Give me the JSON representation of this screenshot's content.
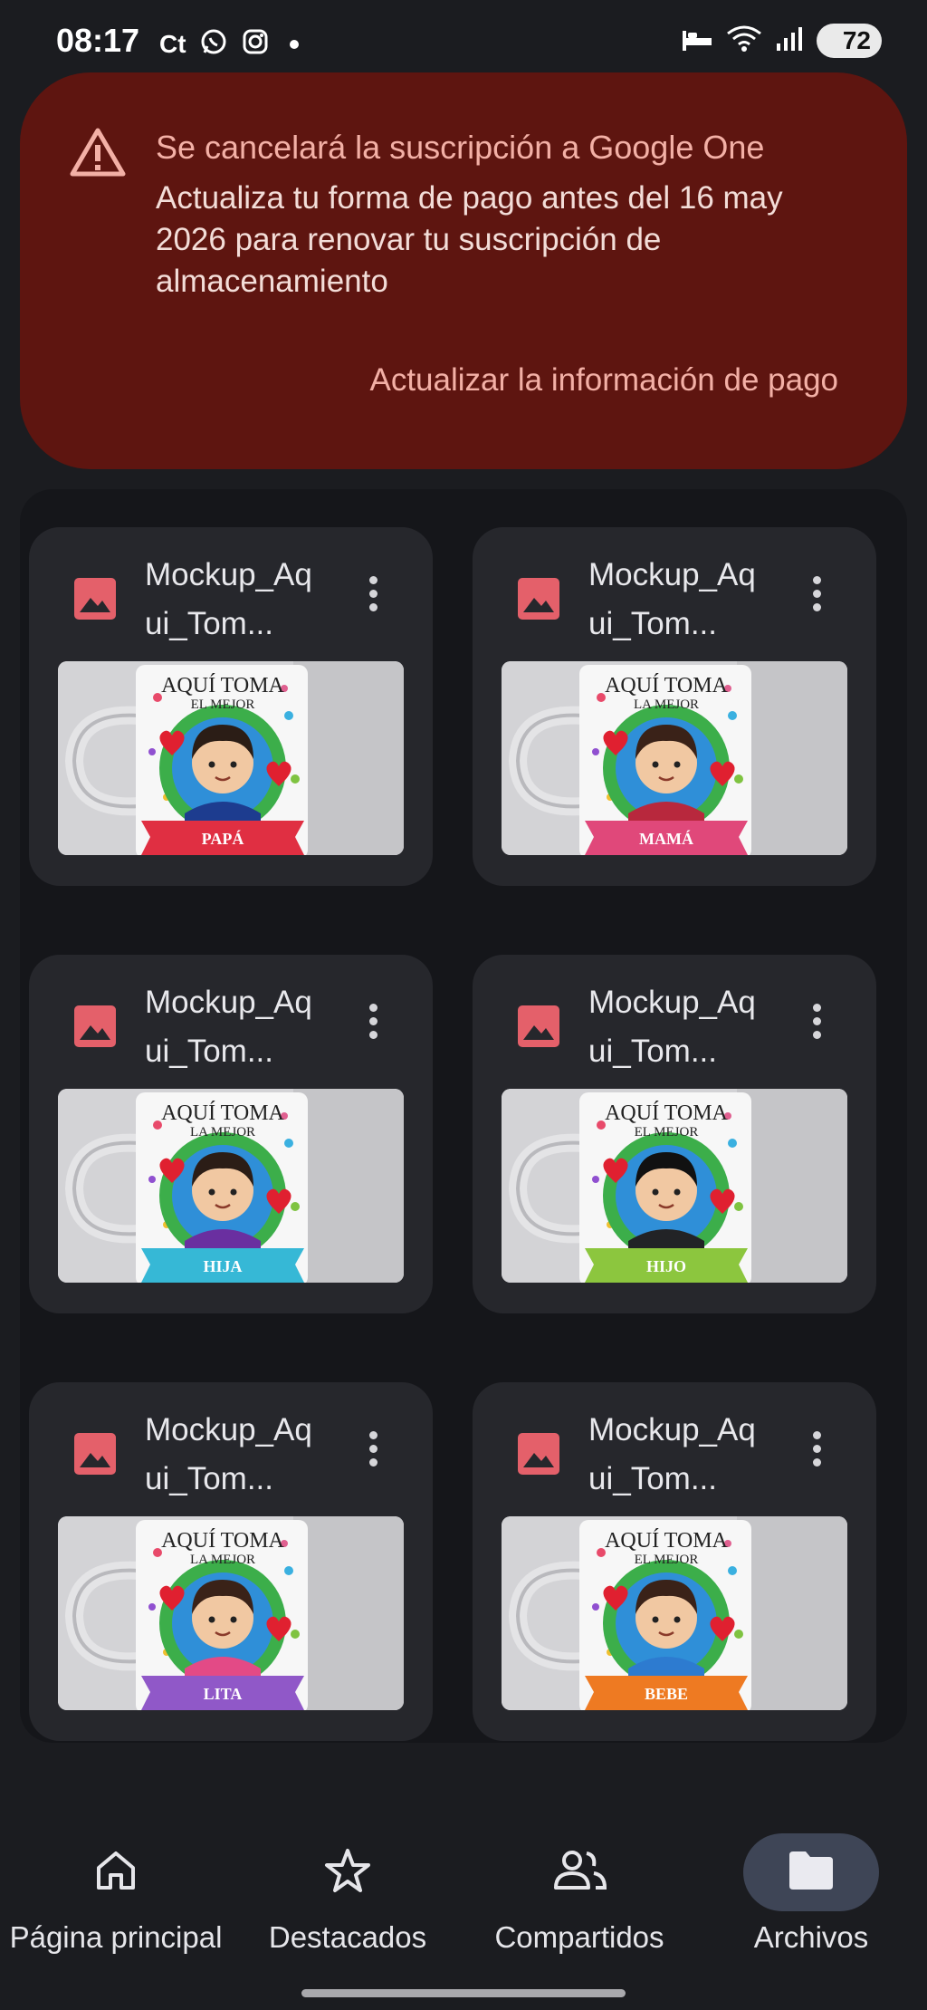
{
  "status_bar": {
    "time": "08:17",
    "carrier_text": "Ct",
    "battery": "72"
  },
  "banner": {
    "title": "Se cancelará la suscripción a Google One",
    "body": "Actualiza tu forma de pago antes del 16 may 2026 para renovar tu suscripción de almacenamiento",
    "action": "Actualizar la información de pago"
  },
  "files": [
    {
      "name": "Mockup_Aqui_Tom...",
      "mug_line1": "AQUÍ TOMA",
      "mug_line2": "EL MEJOR",
      "label": "PAPÁ",
      "ribbon": "#e02f42",
      "shirt": "#1d3c8f",
      "hair": "#2b1d16"
    },
    {
      "name": "Mockup_Aqui_Tom...",
      "mug_line1": "AQUÍ TOMA",
      "mug_line2": "LA MEJOR",
      "label": "MAMÁ",
      "ribbon": "#e0487a",
      "shirt": "#b8283d",
      "hair": "#3a2218"
    },
    {
      "name": "Mockup_Aqui_Tom...",
      "mug_line1": "AQUÍ TOMA",
      "mug_line2": "LA MEJOR",
      "label": "HIJA",
      "ribbon": "#36b8d6",
      "shirt": "#6a2fa0",
      "hair": "#2b1d16"
    },
    {
      "name": "Mockup_Aqui_Tom...",
      "mug_line1": "AQUÍ TOMA",
      "mug_line2": "EL MEJOR",
      "label": "HIJO",
      "ribbon": "#8cc63e",
      "shirt": "#222326",
      "hair": "#111"
    },
    {
      "name": "Mockup_Aqui_Tom...",
      "mug_line1": "AQUÍ TOMA",
      "mug_line2": "LA MEJOR",
      "label": "LITA",
      "ribbon": "#9058c8",
      "shirt": "#e34a86",
      "hair": "#3a2218"
    },
    {
      "name": "Mockup_Aqui_Tom...",
      "mug_line1": "AQUÍ TOMA",
      "mug_line2": "EL MEJOR",
      "label": "BEBE",
      "ribbon": "#ee7a22",
      "shirt": "#2d7bd0",
      "hair": "#3a2218"
    }
  ],
  "nav": [
    {
      "label": "Página principal",
      "icon": "home-icon",
      "active": false
    },
    {
      "label": "Destacados",
      "icon": "star-icon",
      "active": false
    },
    {
      "label": "Compartidos",
      "icon": "people-icon",
      "active": false
    },
    {
      "label": "Archivos",
      "icon": "folder-icon",
      "active": true
    }
  ],
  "colors": {
    "banner_bg": "#5e1510",
    "banner_accent": "#f3b0a6",
    "file_icon": "#e4606a",
    "nav_active_pill": "#3e4556"
  }
}
